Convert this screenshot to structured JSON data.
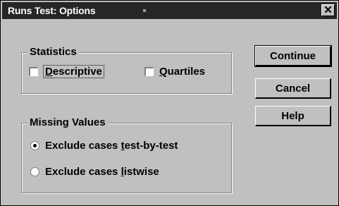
{
  "window": {
    "title": "Runs Test: Options"
  },
  "statistics": {
    "title": "Statistics",
    "descriptive": {
      "label": "Descriptive",
      "checked": false
    },
    "quartiles": {
      "label": "Quartiles",
      "checked": false
    }
  },
  "missing_values": {
    "title": "Missing Values",
    "options": [
      {
        "label": "Exclude cases test-by-test",
        "selected": true
      },
      {
        "label": "Exclude cases listwise",
        "selected": false
      }
    ]
  },
  "buttons": {
    "continue": "Continue",
    "cancel": "Cancel",
    "help": "Help"
  }
}
